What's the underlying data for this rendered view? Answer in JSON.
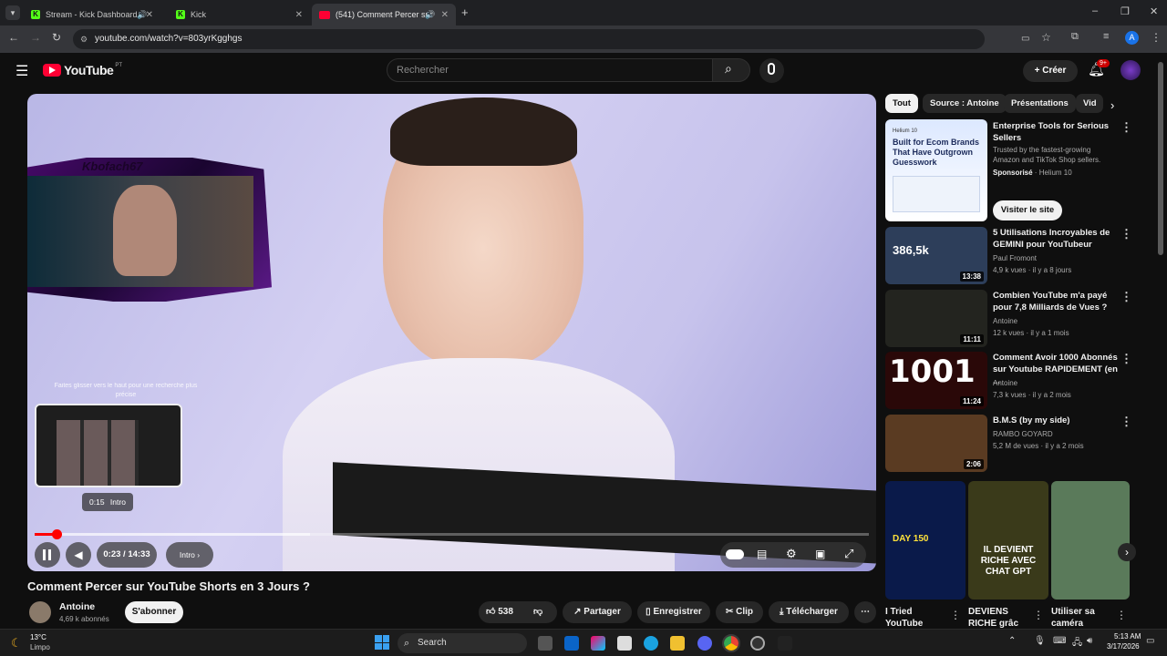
{
  "browser": {
    "tabs": [
      {
        "title": "Stream - Kick Dashboard",
        "active": false
      },
      {
        "title": "Kick",
        "active": false
      },
      {
        "title": "(541) Comment Percer sur",
        "active": true
      }
    ],
    "url": "youtube.com/watch?v=803yrKgghgs",
    "profile_initial": "A"
  },
  "youtube": {
    "logo_text": "YouTube",
    "region": "PT",
    "search_placeholder": "Rechercher",
    "create_label": "Créer",
    "notification_count": "9+"
  },
  "player": {
    "overlay_streamer_name": "Kbofach67",
    "swipe_hint": "Faites glisser vers le haut pour une recherche plus précise",
    "preview_time": "0:15",
    "preview_chapter": "Intro",
    "current_time": "0:23",
    "total_time": "14:33",
    "chapter_label": "Intro",
    "progress_fraction": 0.026,
    "buffered_fraction": 0.33
  },
  "video": {
    "title": "Comment Percer sur YouTube Shorts en 3 Jours ?",
    "channel": "Antoine",
    "subscribers": "4,69 k abonnés",
    "subscribe_label": "S'abonner",
    "likes": "538",
    "share_label": "Partager",
    "save_label": "Enregistrer",
    "clip_label": "Clip",
    "download_label": "Télécharger"
  },
  "chips": [
    "Tout",
    "Source : Antoine",
    "Présentations",
    "Vid"
  ],
  "ad": {
    "thumb_title": "Built for Ecom Brands That Have Outgrown Guesswork",
    "thumb_brand": "Helium 10",
    "title": "Enterprise Tools for Serious Sellers",
    "description": "Trusted by the fastest-growing Amazon and TikTok Shop sellers.",
    "sponsored": "Sponsorisé",
    "advertiser": "Helium 10",
    "cta": "Visiter le site"
  },
  "related": [
    {
      "title": "5 Utilisations Incroyables de GEMINI pour YouTubeur",
      "channel": "Paul Fromont",
      "meta": "4,9 k vues · il y a 8 jours",
      "duration": "13:38",
      "thumb_text": "386,5k",
      "color": "#2d3e5a"
    },
    {
      "title": "Combien YouTube m'a payé pour 7,8 Milliards de Vues ?",
      "channel": "Antoine",
      "meta": "12 k vues · il y a 1 mois",
      "duration": "11:11",
      "thumb_text": "",
      "color": "#23241f"
    },
    {
      "title": "Comment Avoir 1000 Abonnés sur Youtube RAPIDEMENT (en ...",
      "channel": "Antoine",
      "meta": "7,3 k vues · il y a 2 mois",
      "duration": "11:24",
      "thumb_text": "1001",
      "color": "#2a0808"
    },
    {
      "title": "B.M.S (by my side)",
      "channel": "RAMBO GOYARD",
      "meta": "5,2 M de vues · il y a 2 mois",
      "duration": "2:06",
      "thumb_text": "",
      "color": "#5a3b22"
    }
  ],
  "shorts": [
    {
      "title": "I Tried YouTube",
      "thumb_text": "DAY 150",
      "color": "#0a1a4a"
    },
    {
      "title": "DEVIENS RICHE grâc",
      "thumb_text": "IL DEVIENT RICHE AVEC CHAT GPT",
      "color": "#3a3a1a"
    },
    {
      "title": "Utiliser sa caméra",
      "thumb_text": "",
      "color": "#5a7a5a"
    }
  ],
  "taskbar": {
    "temperature": "13°C",
    "weather": "Limpo",
    "search_label": "Search",
    "time": "5:13 AM",
    "date": "3/17/2026"
  }
}
